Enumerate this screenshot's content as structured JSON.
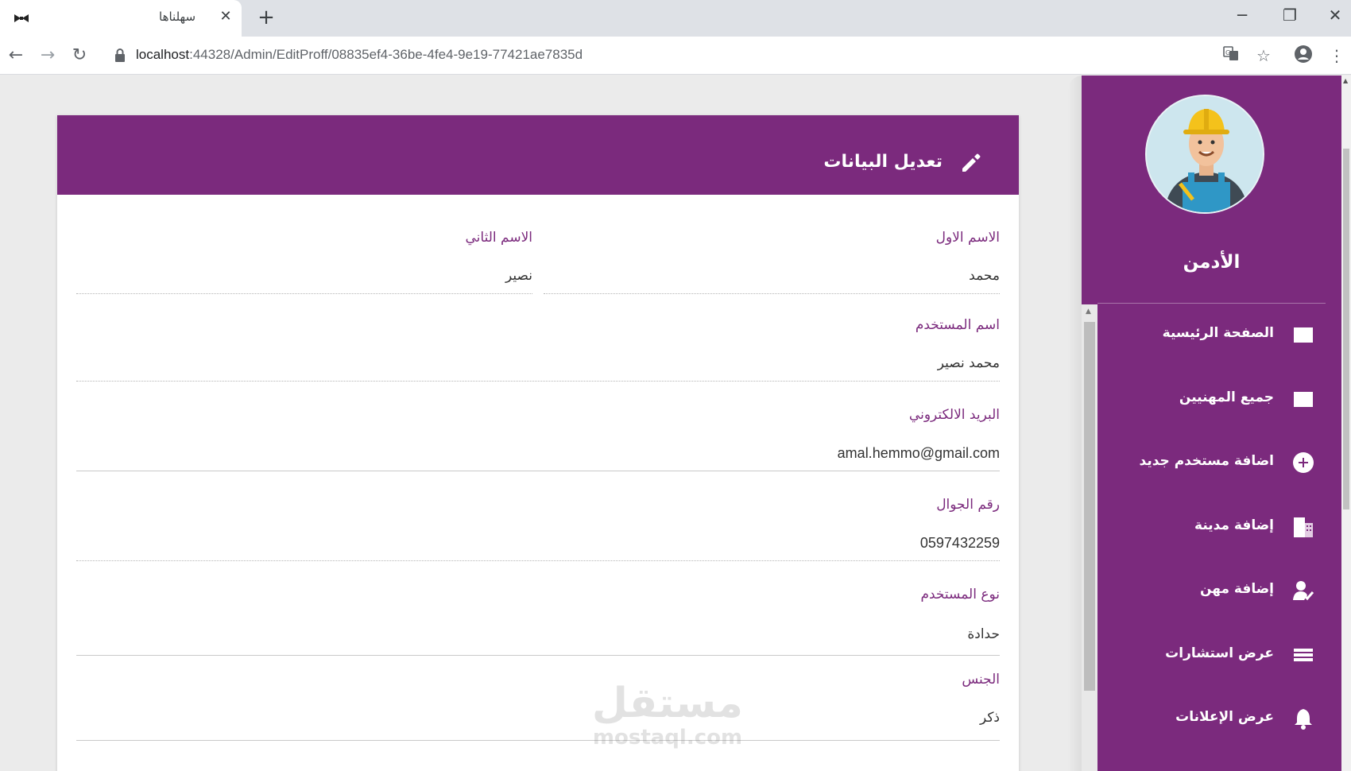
{
  "browser": {
    "tab_title": "سهلناها",
    "tab_close": "✕",
    "new_tab": "+",
    "url_host": "localhost",
    "url_path": ":44328/Admin/EditProff/08835ef4-36be-4fe4-9e19-77421ae7835d"
  },
  "form": {
    "title": "تعديل البيانات",
    "fields": {
      "first_name": {
        "label": "الاسم الاول",
        "value": "محمد"
      },
      "last_name": {
        "label": "الاسم الثاني",
        "value": "نصير"
      },
      "username": {
        "label": "اسم المستخدم",
        "value": "محمد نصير"
      },
      "email": {
        "label": "البريد الالكتروني",
        "value": "amal.hemmo@gmail.com"
      },
      "phone": {
        "label": "رقم الجوال",
        "value": "0597432259"
      },
      "user_type": {
        "label": "نوع المستخدم",
        "value": "حدادة"
      },
      "gender": {
        "label": "الجنس",
        "value": "ذكر"
      }
    }
  },
  "sidebar": {
    "admin_name": "الأدمن",
    "items": [
      {
        "label": "الصفحة الرئيسية",
        "icon": "square-icon"
      },
      {
        "label": "جميع المهنيين",
        "icon": "square-icon"
      },
      {
        "label": "اضافة مستخدم جديد",
        "icon": "plus-circle-icon"
      },
      {
        "label": "إضافة مدينة",
        "icon": "building-icon"
      },
      {
        "label": "إضافة مهن",
        "icon": "user-check-icon"
      },
      {
        "label": "عرض استشارات",
        "icon": "list-icon"
      },
      {
        "label": "عرض الإعلانات",
        "icon": "bell-icon"
      }
    ]
  },
  "watermark": {
    "arabic": "مستقل",
    "latin": "mostaql.com"
  },
  "colors": {
    "brand": "#7b2a7d",
    "label": "#7b2a7d"
  }
}
